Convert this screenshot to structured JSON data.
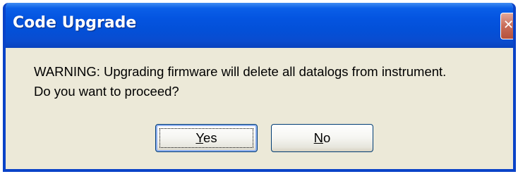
{
  "dialog": {
    "title": "Code Upgrade",
    "close_icon": "close-icon",
    "message_line1": "WARNING: Upgrading firmware will delete all datalogs from instrument.",
    "message_line2": "Do you want to proceed?",
    "yes_label": {
      "mnemonic": "Y",
      "rest": "es"
    },
    "no_label": {
      "mnemonic": "N",
      "rest": "o"
    }
  },
  "colors": {
    "titlebar": "#0454e0",
    "frame": "#0a43c8",
    "dialog_background": "#ece9d8",
    "close_button": "#c96c58"
  }
}
